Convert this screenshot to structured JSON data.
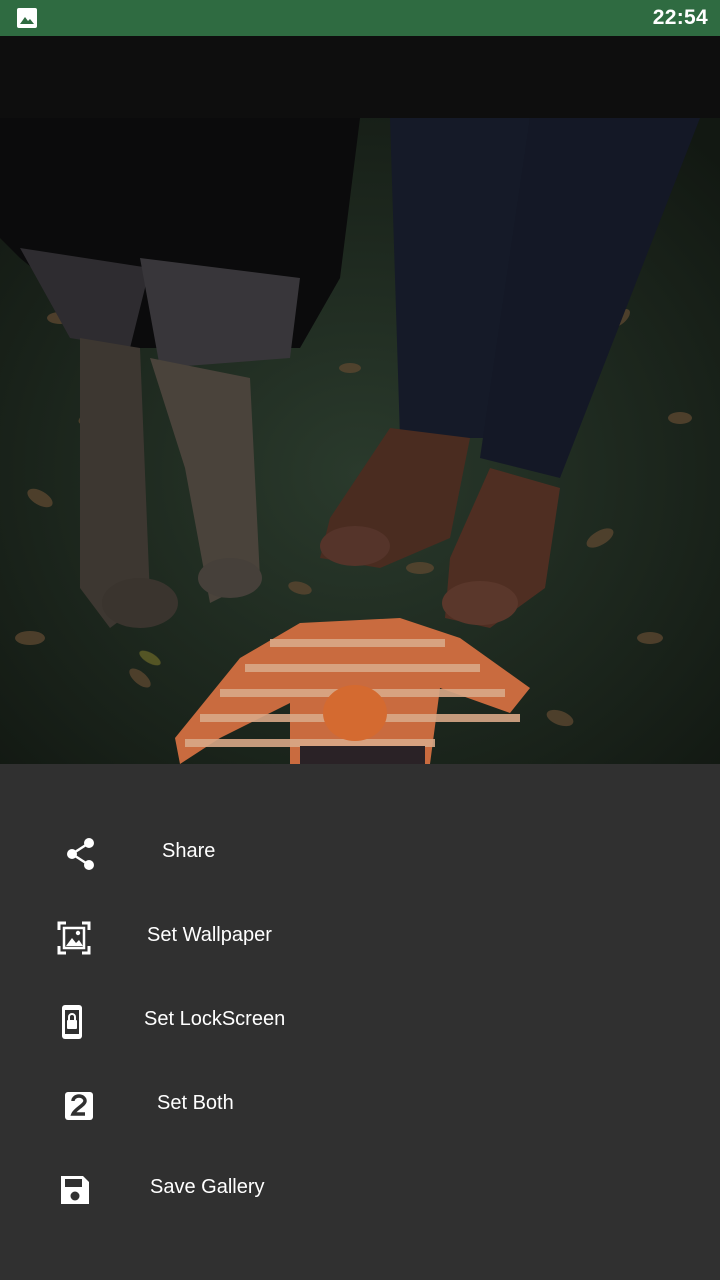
{
  "status_bar": {
    "time": "22:54",
    "notification_icon": "image-icon"
  },
  "photo": {
    "description_icon": "wallpaper-image"
  },
  "menu": {
    "items": [
      {
        "label": "Share",
        "icon": "share-icon"
      },
      {
        "label": "Set Wallpaper",
        "icon": "wallpaper-icon"
      },
      {
        "label": "Set LockScreen",
        "icon": "lockscreen-icon"
      },
      {
        "label": "Set Both",
        "icon": "both-icon"
      },
      {
        "label": "Save Gallery",
        "icon": "save-icon"
      }
    ]
  },
  "colors": {
    "status_bar": "#2f6b41",
    "sheet_background": "#303030",
    "text": "#ffffff"
  }
}
